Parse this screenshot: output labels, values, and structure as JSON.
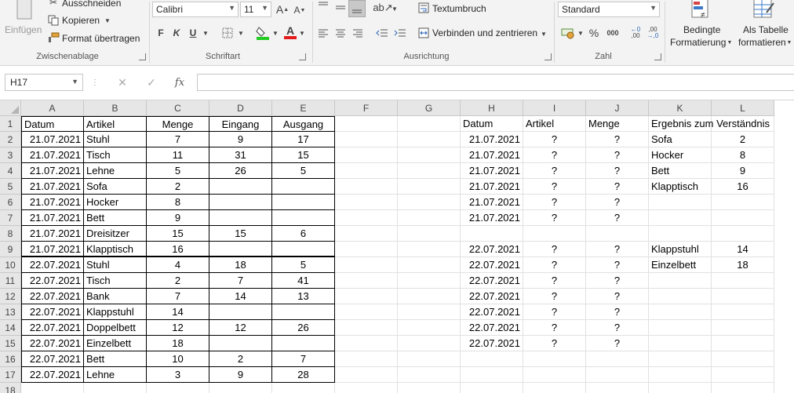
{
  "ribbon": {
    "clipboard": {
      "paste_label": "Einfügen",
      "cut_label": "Ausschneiden",
      "copy_label": "Kopieren",
      "format_painter_label": "Format übertragen",
      "group_label": "Zwischenablage"
    },
    "font": {
      "font_name": "Calibri",
      "font_size": "11",
      "bold": "F",
      "italic": "K",
      "underline": "U",
      "increase_size": "A",
      "decrease_size": "A",
      "font_color_letter": "A",
      "group_label": "Schriftart"
    },
    "alignment": {
      "wrap_text_label": "Textumbruch",
      "merge_center_label": "Verbinden und zentrieren",
      "group_label": "Ausrichtung"
    },
    "number": {
      "format_value": "Standard",
      "percent": "%",
      "thousands": "000",
      "group_label": "Zahl"
    },
    "styles": {
      "conditional_line1": "Bedingte",
      "conditional_line2": "Formatierung",
      "table_line1": "Als Tabelle",
      "table_line2": "formatieren"
    }
  },
  "formula_bar": {
    "name_box": "H17",
    "fx_label": "fx",
    "content": ""
  },
  "columns": [
    "A",
    "B",
    "C",
    "D",
    "E",
    "F",
    "G",
    "H",
    "I",
    "J",
    "K",
    "L"
  ],
  "rows": [
    "1",
    "2",
    "3",
    "4",
    "5",
    "6",
    "7",
    "8",
    "9",
    "10",
    "11",
    "12",
    "13",
    "14",
    "15",
    "16",
    "17",
    "18"
  ],
  "sheet": {
    "header": [
      "Datum",
      "Artikel",
      "Menge",
      "Eingang",
      "Ausgang"
    ],
    "data": [
      [
        "21.07.2021",
        "Stuhl",
        "7",
        "9",
        "17"
      ],
      [
        "21.07.2021",
        "Tisch",
        "11",
        "31",
        "15"
      ],
      [
        "21.07.2021",
        "Lehne",
        "5",
        "26",
        "5"
      ],
      [
        "21.07.2021",
        "Sofa",
        "2",
        "",
        ""
      ],
      [
        "21.07.2021",
        "Hocker",
        "8",
        "",
        ""
      ],
      [
        "21.07.2021",
        "Bett",
        "9",
        "",
        ""
      ],
      [
        "21.07.2021",
        "Dreisitzer",
        "15",
        "15",
        "6"
      ],
      [
        "21.07.2021",
        "Klapptisch",
        "16",
        "",
        ""
      ],
      [
        "22.07.2021",
        "Stuhl",
        "4",
        "18",
        "5"
      ],
      [
        "22.07.2021",
        "Tisch",
        "2",
        "7",
        "41"
      ],
      [
        "22.07.2021",
        "Bank",
        "7",
        "14",
        "13"
      ],
      [
        "22.07.2021",
        "Klappstuhl",
        "14",
        "",
        ""
      ],
      [
        "22.07.2021",
        "Doppelbett",
        "12",
        "12",
        "26"
      ],
      [
        "22.07.2021",
        "Einzelbett",
        "18",
        "",
        ""
      ],
      [
        "22.07.2021",
        "Bett",
        "10",
        "2",
        "7"
      ],
      [
        "22.07.2021",
        "Lehne",
        "3",
        "9",
        "28"
      ]
    ],
    "result_header": [
      "Datum",
      "Artikel",
      "Menge"
    ],
    "result_rows": [
      [
        "21.07.2021",
        "?",
        "?"
      ],
      [
        "21.07.2021",
        "?",
        "?"
      ],
      [
        "21.07.2021",
        "?",
        "?"
      ],
      [
        "21.07.2021",
        "?",
        "?"
      ],
      [
        "21.07.2021",
        "?",
        "?"
      ],
      [
        "21.07.2021",
        "?",
        "?"
      ],
      [
        "",
        "",
        ""
      ],
      [
        "22.07.2021",
        "?",
        "?"
      ],
      [
        "22.07.2021",
        "?",
        "?"
      ],
      [
        "22.07.2021",
        "?",
        "?"
      ],
      [
        "22.07.2021",
        "?",
        "?"
      ],
      [
        "22.07.2021",
        "?",
        "?"
      ],
      [
        "22.07.2021",
        "?",
        "?"
      ],
      [
        "22.07.2021",
        "?",
        "?"
      ]
    ],
    "explain_header": "Ergebnis zum Verständnis",
    "explain_rows": [
      [
        "Sofa",
        "2"
      ],
      [
        "Hocker",
        "8"
      ],
      [
        "Bett",
        "9"
      ],
      [
        "Klapptisch",
        "16"
      ],
      [
        "",
        ""
      ],
      [
        "",
        ""
      ],
      [
        "",
        ""
      ],
      [
        "Klappstuhl",
        "14"
      ],
      [
        " Einzelbett",
        "18"
      ]
    ]
  }
}
